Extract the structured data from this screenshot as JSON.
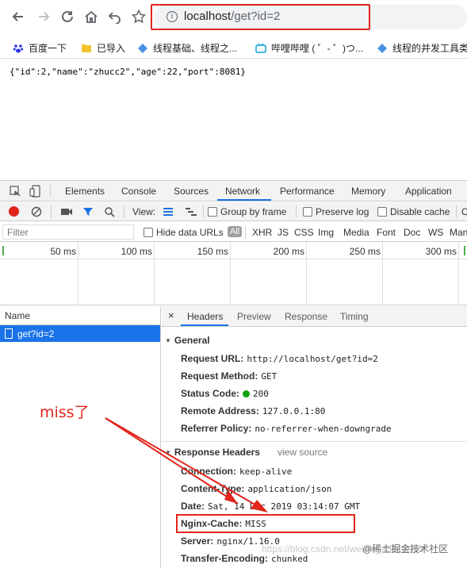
{
  "browser": {
    "url_host": "localhost",
    "url_path": "/get?id=2",
    "bookmarks": [
      {
        "label": "百度一下"
      },
      {
        "label": "已导入"
      },
      {
        "label": "线程基础、线程之..."
      },
      {
        "label": "哔哩哔哩 ( ゜- ゜)つ..."
      },
      {
        "label": "线程的并发工具类"
      }
    ]
  },
  "page": {
    "body_text": "{\"id\":2,\"name\":\"zhucc2\",\"age\":22,\"port\":8081}"
  },
  "devtools": {
    "tabs": [
      "Elements",
      "Console",
      "Sources",
      "Network",
      "Performance",
      "Memory",
      "Application"
    ],
    "active_tab": "Network",
    "toolbar": {
      "view_label": "View:",
      "group_by_frame": "Group by frame",
      "preserve_log": "Preserve log",
      "disable_cache": "Disable cache",
      "online_prefix": "O"
    },
    "filter": {
      "placeholder": "Filter",
      "hide_data_urls": "Hide data URLs",
      "all": "All",
      "types": [
        "XHR",
        "JS",
        "CSS",
        "Img",
        "Media",
        "Font",
        "Doc",
        "WS",
        "Manifest"
      ]
    },
    "timeline_ticks": [
      "50 ms",
      "100 ms",
      "150 ms",
      "200 ms",
      "250 ms",
      "300 ms"
    ],
    "requests": {
      "header": "Name",
      "items": [
        {
          "name": "get?id=2"
        }
      ]
    },
    "detail": {
      "close": "×",
      "tabs": [
        "Headers",
        "Preview",
        "Response",
        "Timing"
      ],
      "active_tab": "Headers",
      "general_title": "General",
      "general": [
        {
          "k": "Request URL:",
          "v": "http://localhost/get?id=2"
        },
        {
          "k": "Request Method:",
          "v": "GET"
        },
        {
          "k": "Status Code:",
          "v": "200"
        },
        {
          "k": "Remote Address:",
          "v": "127.0.0.1:80"
        },
        {
          "k": "Referrer Policy:",
          "v": "no-referrer-when-downgrade"
        }
      ],
      "response_title": "Response Headers",
      "view_source": "view source",
      "response": [
        {
          "k": "Connection:",
          "v": "keep-alive"
        },
        {
          "k": "Content-Type:",
          "v": "application/json"
        },
        {
          "k": "Date:",
          "v": "Sat, 14 Dec 2019 03:14:07 GMT"
        },
        {
          "k": "Nginx-Cache:",
          "v": "MISS"
        },
        {
          "k": "Server:",
          "v": "nginx/1.16.0"
        },
        {
          "k": "Transfer-Encoding:",
          "v": "chunked"
        }
      ]
    }
  },
  "annotation": {
    "label": "miss了",
    "color": "#e1251b"
  },
  "watermark": {
    "text": "https://blog.csdn.net/weixin_43517958",
    "brand": "@稀土掘金技术社区"
  }
}
